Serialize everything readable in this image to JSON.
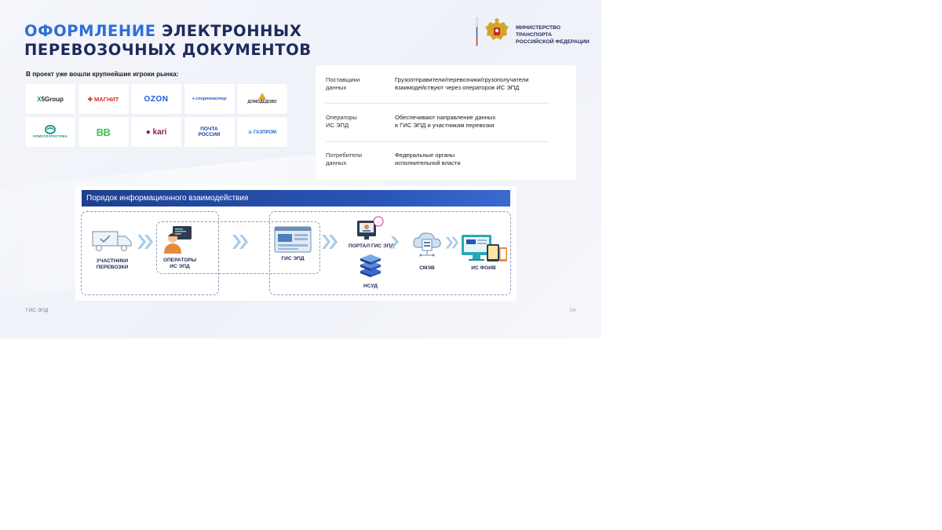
{
  "header": {
    "title_line1_accent": "ОФОРМЛЕНИЕ",
    "title_line1_rest": "ЭЛЕКТРОННЫХ",
    "title_line2": "ПЕРЕВОЗОЧНЫХ ДОКУМЕНТОВ",
    "ministry_line1": "МИНИСТЕРСТВО ТРАНСПОРТА",
    "ministry_line2": "РОССИЙСКОЙ ФЕДЕРАЦИИ",
    "emblem_icon": "coat-of-arms-icon"
  },
  "players": {
    "caption": "В проект уже вошли крупнейшие игроки рынка:",
    "logos": [
      {
        "name": "X5 Group"
      },
      {
        "name": "МАГНИТ"
      },
      {
        "name": "OZON"
      },
      {
        "name": "спортмастер"
      },
      {
        "name": "ДОМОДЕДОВО"
      },
      {
        "name": "КОМУСЛОГИСТИКА"
      },
      {
        "name": "BB"
      },
      {
        "name": "kari"
      },
      {
        "name": "ПОЧТА РОССИИ"
      },
      {
        "name": "ГАЗПРОМ"
      }
    ]
  },
  "info": {
    "rows": [
      {
        "key_line1": "Поставщики",
        "key_line2": "данных",
        "value_line1": "Грузоотправители/перевозчики/грузополучатели",
        "value_line2": "взаимодействуют через операторов ИС ЭПД"
      },
      {
        "key_line1": "Операторы",
        "key_line2": "ИС ЭПД",
        "value_line1": "Обеспечивают направление данных",
        "value_line2": "в ГИС ЭПД и участникам перевозки"
      },
      {
        "key_line1": "Потребители",
        "key_line2": "данных",
        "value_line1": "Федеральные органы",
        "value_line2": "исполнительной власти"
      }
    ]
  },
  "diagram": {
    "header": "Порядок информационного взаимодействия",
    "nodes": {
      "participants_l1": "УЧАСТНИКИ",
      "participants_l2": "ПЕРЕВОЗКИ",
      "operators_l1": "ОПЕРАТОРЫ",
      "operators_l2": "ИС ЭПД",
      "gis": "ГИС ЭПД",
      "portal": "ПОРТАЛ ГИС ЭПД",
      "nsud": "НСУД",
      "smev": "СМЭВ",
      "foiv": "ИС ФОИВ"
    },
    "icons": [
      "truck-icon",
      "operator-icon",
      "gis-window-icon",
      "portal-icon",
      "database-stack-icon",
      "cloud-server-icon",
      "monitor-devices-icon"
    ]
  },
  "footer": {
    "left": "ГИС ЭПД",
    "page": "04"
  },
  "colors": {
    "title": "#1f2a5c",
    "accent": "#2f6fd6",
    "diagram_header": "#1e3f91"
  }
}
